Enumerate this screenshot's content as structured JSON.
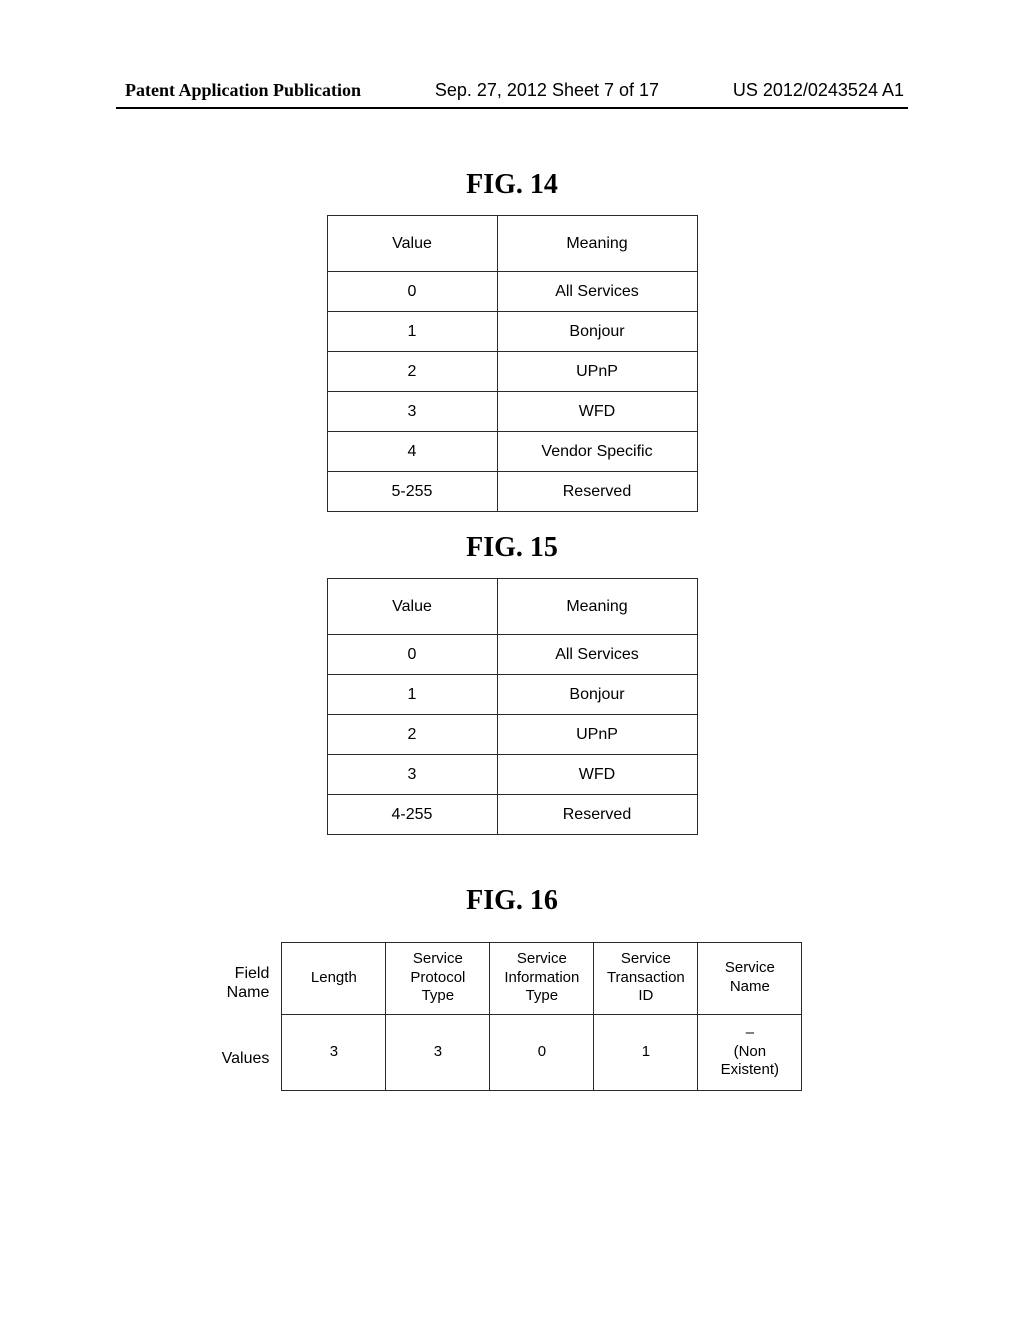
{
  "header": {
    "left": "Patent Application Publication",
    "center": "Sep. 27, 2012  Sheet 7 of 17",
    "right": "US 2012/0243524 A1"
  },
  "fig14": {
    "title": "FIG.  14",
    "headers": [
      "Value",
      "Meaning"
    ],
    "rows": [
      [
        "0",
        "All Services"
      ],
      [
        "1",
        "Bonjour"
      ],
      [
        "2",
        "UPnP"
      ],
      [
        "3",
        "WFD"
      ],
      [
        "4",
        "Vendor Specific"
      ],
      [
        "5-255",
        "Reserved"
      ]
    ]
  },
  "fig15": {
    "title": "FIG.  15",
    "headers": [
      "Value",
      "Meaning"
    ],
    "rows": [
      [
        "0",
        "All Services"
      ],
      [
        "1",
        "Bonjour"
      ],
      [
        "2",
        "UPnP"
      ],
      [
        "3",
        "WFD"
      ],
      [
        "4-255",
        "Reserved"
      ]
    ]
  },
  "fig16": {
    "title": "FIG.  16",
    "rowLabels": {
      "field": "Field\nName",
      "values": "Values"
    },
    "fieldRow": [
      "Length",
      "Service\nProtocol\nType",
      "Service\nInformation\nType",
      "Service\nTransaction\nID",
      "Service\nName"
    ],
    "valuesRow": [
      "3",
      "3",
      "0",
      "1",
      "–\n(Non\nExistent)"
    ]
  }
}
